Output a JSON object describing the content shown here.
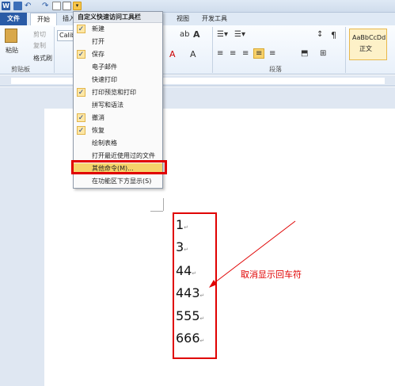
{
  "ribbon_tabs": {
    "file": "文件",
    "home": "开始",
    "insert": "插入",
    "view": "视图",
    "developer": "开发工具"
  },
  "clipboard": {
    "paste": "粘贴",
    "cut": "剪切",
    "copy": "复制",
    "format_painter": "格式刷",
    "group": "剪贴板"
  },
  "font": {
    "name": "Calib"
  },
  "paragraph": {
    "group": "段落"
  },
  "styles": {
    "sample": "AaBbCcDd",
    "normal": "正文"
  },
  "qat_menu": {
    "title": "自定义快速访问工具栏",
    "items": [
      {
        "label": "新建",
        "checked": true
      },
      {
        "label": "打开",
        "checked": false
      },
      {
        "label": "保存",
        "checked": true
      },
      {
        "label": "电子邮件",
        "checked": false
      },
      {
        "label": "快速打印",
        "checked": false
      },
      {
        "label": "打印预览和打印",
        "checked": true
      },
      {
        "label": "拼写和语法",
        "checked": false
      },
      {
        "label": "撤消",
        "checked": true
      },
      {
        "label": "恢复",
        "checked": true
      },
      {
        "label": "绘制表格",
        "checked": false
      },
      {
        "label": "打开最近使用过的文件",
        "checked": false
      },
      {
        "label": "其他命令(M)...",
        "checked": false,
        "highlighted": true
      },
      {
        "label": "在功能区下方显示(S)",
        "checked": false
      }
    ]
  },
  "document": {
    "lines": [
      "1",
      "3",
      "44",
      "443",
      "555",
      "666"
    ],
    "para_mark": "↵"
  },
  "annotation": {
    "text": "取消显示回车符"
  },
  "colors": {
    "highlight_red": "#e00000",
    "file_tab": "#2a5ba6"
  }
}
